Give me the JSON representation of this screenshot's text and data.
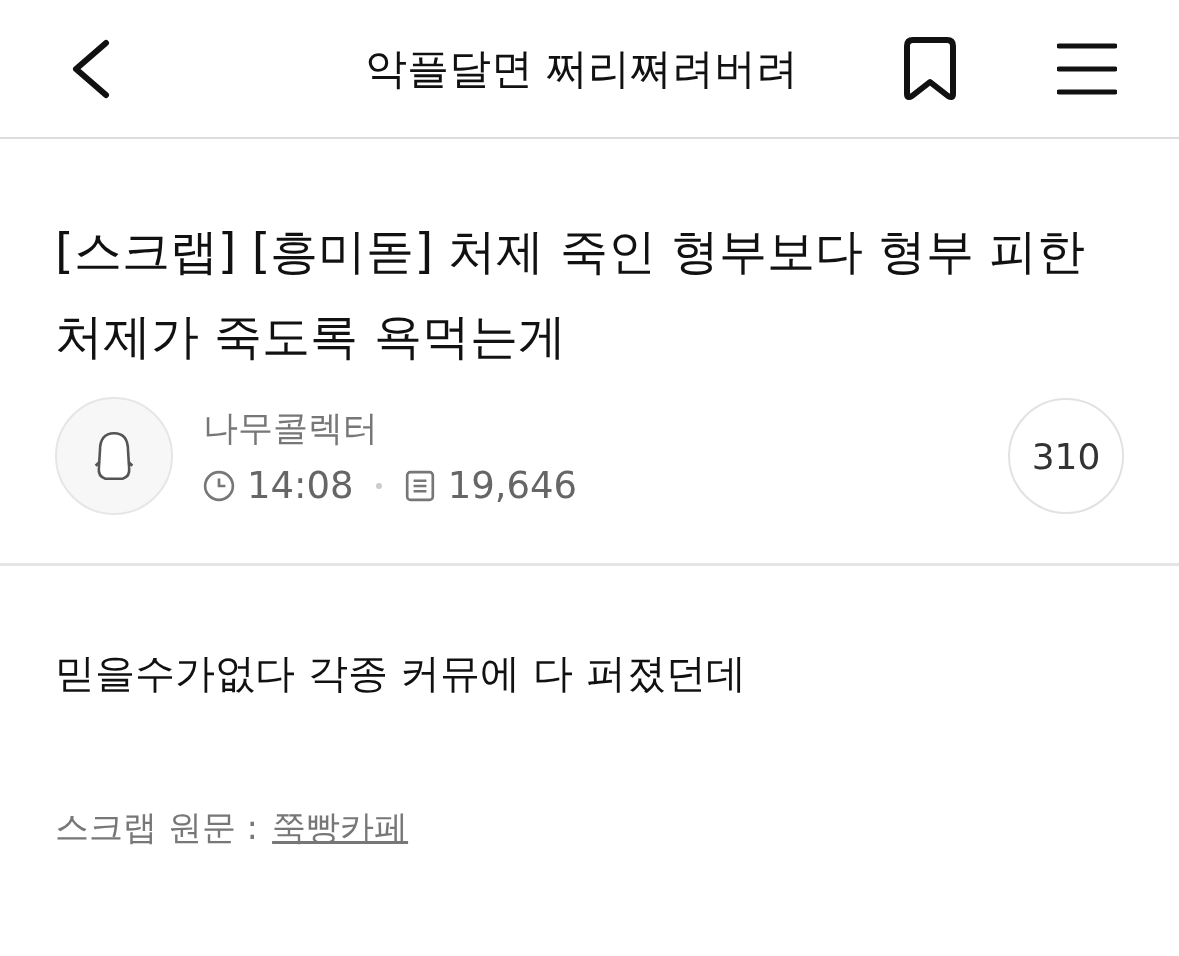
{
  "header": {
    "title": "악플달면 쩌리쪄려버려"
  },
  "post": {
    "title": "[스크랩] [흥미돋] 처제 죽인 형부보다 형부 피한 처제가 죽도록 욕먹는게",
    "author": "나무콜렉터",
    "time": "14:08",
    "views": "19,646",
    "comments": "310"
  },
  "body": {
    "text": "믿을수가없다 각종 커뮤에 다 퍼졌던데",
    "source_label": "스크랩 원문 :",
    "source_link": "쭉빵카페"
  }
}
